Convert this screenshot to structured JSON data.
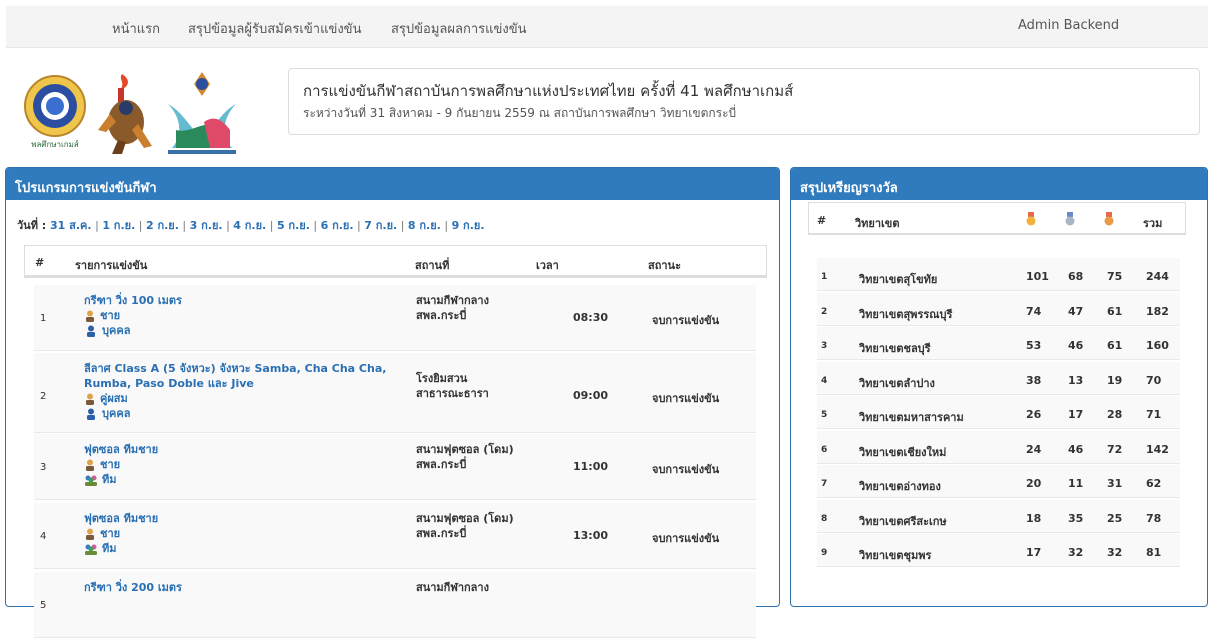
{
  "nav": {
    "home": "หน้าแรก",
    "applicants": "สรุปข้อมูลผู้รับสมัครเข้าแข่งขัน",
    "results": "สรุปข้อมูลผลการแข่งขัน",
    "admin": "Admin Backend"
  },
  "header": {
    "title": "การแข่งขันกีฬาสถาบันการพลศึกษาแห่งประเทศไทย ครั้งที่ 41 พลศึกษาเกมส์",
    "subtitle": "ระหว่างวันที่ 31 สิงหาคม - 9 กันยายน 2559 ณ สถาบันการพลศึกษา วิทยาเขตกระบี่"
  },
  "schedule": {
    "panel_title": "โปรแกรมการแข่งขันกีฬา",
    "day_label": "วันที่ :",
    "days": [
      "31 ส.ค.",
      "1 ก.ย.",
      "2 ก.ย.",
      "3 ก.ย.",
      "4 ก.ย.",
      "5 ก.ย.",
      "6 ก.ย.",
      "7 ก.ย.",
      "8 ก.ย.",
      "9 ก.ย."
    ],
    "columns": [
      "#",
      "รายการแข่งขัน",
      "สถานที่",
      "เวลา",
      "สถานะ"
    ],
    "rows": [
      {
        "no": "1",
        "event": [
          "กรีฑา วิ่ง 100 เมตร"
        ],
        "gender": "ชาย",
        "type": "บุคคล",
        "venue": [
          "สนามกีฬากลาง",
          "สพล.กระบี่"
        ],
        "time": "08:30",
        "status": "จบการแข่งขัน"
      },
      {
        "no": "2",
        "event": [
          "ลีลาศ Class A (5 จังหวะ) จังหวะ Samba, Cha Cha Cha,",
          "Rumba, Paso Doble และ Jive"
        ],
        "gender": "คู่ผสม",
        "type": "บุคคล",
        "venue": [
          "โรงยิมสวน",
          "สาธารณะธารา"
        ],
        "time": "09:00",
        "status": "จบการแข่งขัน"
      },
      {
        "no": "3",
        "event": [
          "ฟุตซอล ทีมชาย"
        ],
        "gender": "ชาย",
        "type": "ทีม",
        "venue": [
          "สนามฟุตซอล (โดม)",
          "สพล.กระบี่"
        ],
        "time": "11:00",
        "status": "จบการแข่งขัน"
      },
      {
        "no": "4",
        "event": [
          "ฟุตซอล ทีมชาย"
        ],
        "gender": "ชาย",
        "type": "ทีม",
        "venue": [
          "สนามฟุตซอล (โดม)",
          "สพล.กระบี่"
        ],
        "time": "13:00",
        "status": "จบการแข่งขัน"
      },
      {
        "no": "5",
        "event": [
          "กรีฑา วิ่ง 200 เมตร"
        ],
        "gender": "",
        "type": "",
        "venue": [
          "สนามกีฬากลาง",
          ""
        ],
        "time": "",
        "status": ""
      }
    ]
  },
  "medals": {
    "panel_title": "สรุปเหรียญรางวัล",
    "columns": {
      "no": "#",
      "campus": "วิทยาเขต",
      "total": "รวม"
    },
    "colors": {
      "gold": "#f2b23a",
      "silver": "#aab4c4",
      "bronze": "#e59b47"
    },
    "rows": [
      {
        "no": "1",
        "campus": "วิทยาเขตสุโขทัย",
        "gold": "101",
        "silver": "68",
        "bronze": "75",
        "total": "244"
      },
      {
        "no": "2",
        "campus": "วิทยาเขตสุพรรณบุรี",
        "gold": "74",
        "silver": "47",
        "bronze": "61",
        "total": "182"
      },
      {
        "no": "3",
        "campus": "วิทยาเขตชลบุรี",
        "gold": "53",
        "silver": "46",
        "bronze": "61",
        "total": "160"
      },
      {
        "no": "4",
        "campus": "วิทยาเขตลำปาง",
        "gold": "38",
        "silver": "13",
        "bronze": "19",
        "total": "70"
      },
      {
        "no": "5",
        "campus": "วิทยาเขตมหาสารคาม",
        "gold": "26",
        "silver": "17",
        "bronze": "28",
        "total": "71"
      },
      {
        "no": "6",
        "campus": "วิทยาเขตเชียงใหม่",
        "gold": "24",
        "silver": "46",
        "bronze": "72",
        "total": "142"
      },
      {
        "no": "7",
        "campus": "วิทยาเขตอ่างทอง",
        "gold": "20",
        "silver": "11",
        "bronze": "31",
        "total": "62"
      },
      {
        "no": "8",
        "campus": "วิทยาเขตศรีสะเกษ",
        "gold": "18",
        "silver": "35",
        "bronze": "25",
        "total": "78"
      },
      {
        "no": "9",
        "campus": "วิทยาเขตชุมพร",
        "gold": "17",
        "silver": "32",
        "bronze": "32",
        "total": "81"
      }
    ]
  },
  "logos": {
    "logo1_text": "พลศึกษาเกมส์"
  }
}
